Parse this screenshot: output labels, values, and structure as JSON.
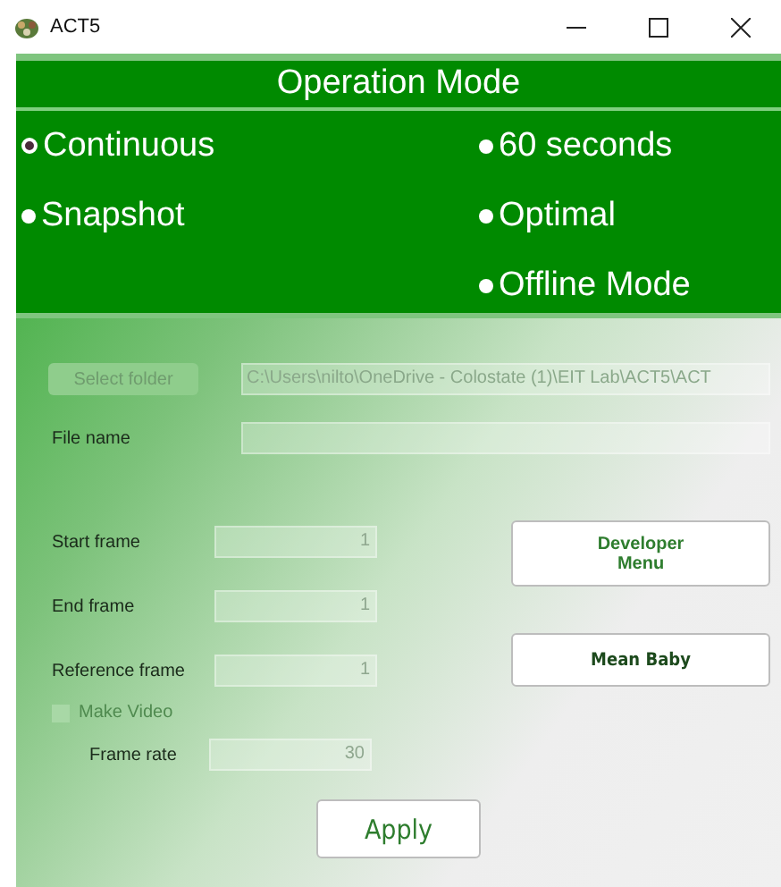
{
  "window": {
    "title": "ACT5"
  },
  "operation_mode": {
    "title": "Operation Mode",
    "left_options": [
      {
        "label": "Continuous",
        "selected": true
      },
      {
        "label": "Snapshot",
        "selected": false
      }
    ],
    "right_options": [
      {
        "label": "60 seconds",
        "selected": false
      },
      {
        "label": "Optimal",
        "selected": false
      },
      {
        "label": "Offline Mode",
        "selected": false
      }
    ]
  },
  "folder": {
    "button": "Select folder",
    "button_disabled": true,
    "path": "C:\\Users\\nilto\\OneDrive - Colostate (1)\\EIT Lab\\ACT5\\ACT"
  },
  "file_name": {
    "label": "File name"
  },
  "frames": [
    {
      "label": "Start frame",
      "value": "1"
    },
    {
      "label": "End frame",
      "value": "1"
    },
    {
      "label": "Reference frame",
      "value": "1"
    }
  ],
  "make_video": {
    "label": "Make Video",
    "checked": false,
    "disabled": true
  },
  "frame_rate": {
    "label": "Frame rate",
    "value": "30"
  },
  "side_buttons": [
    "Developer\nMenu",
    "Mean Baby"
  ],
  "apply_button": "Apply"
}
